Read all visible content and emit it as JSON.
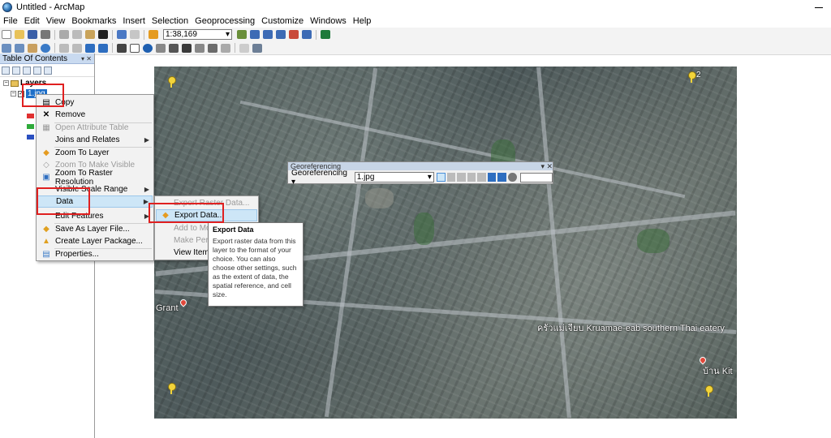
{
  "window": {
    "title": "Untitled - ArcMap"
  },
  "menu": [
    "File",
    "Edit",
    "View",
    "Bookmarks",
    "Insert",
    "Selection",
    "Geoprocessing",
    "Customize",
    "Windows",
    "Help"
  ],
  "toolbar": {
    "scale": "1:38,169"
  },
  "toc": {
    "title": "Table Of Contents",
    "layers_label": "Layers",
    "layer_name": "1.jpg",
    "bands": [
      "red",
      "green",
      "blue"
    ]
  },
  "context_menu": {
    "items": [
      {
        "label": "Copy",
        "icon": "copy-icon",
        "enabled": true
      },
      {
        "label": "Remove",
        "icon": "remove-icon",
        "enabled": true
      },
      {
        "label": "Open Attribute Table",
        "icon": "table-icon",
        "enabled": false
      },
      {
        "label": "Joins and Relates",
        "icon": "",
        "enabled": true,
        "submenu": true
      },
      {
        "label": "Zoom To Layer",
        "icon": "zoom-to-layer-icon",
        "enabled": true
      },
      {
        "label": "Zoom To Make Visible",
        "icon": "zoom-visible-icon",
        "enabled": false
      },
      {
        "label": "Zoom To Raster Resolution",
        "icon": "raster-resolution-icon",
        "enabled": true
      },
      {
        "label": "Visible Scale Range",
        "icon": "",
        "enabled": true,
        "submenu": true
      },
      {
        "label": "Data",
        "icon": "",
        "enabled": true,
        "submenu": true,
        "highlighted": true
      },
      {
        "label": "Edit Features",
        "icon": "",
        "enabled": true,
        "submenu": true
      },
      {
        "label": "Save As Layer File...",
        "icon": "save-layer-icon",
        "enabled": true
      },
      {
        "label": "Create Layer Package...",
        "icon": "layer-package-icon",
        "enabled": true
      },
      {
        "label": "Properties...",
        "icon": "properties-icon",
        "enabled": true
      }
    ]
  },
  "data_submenu": {
    "items": [
      {
        "label": "Export Data...",
        "highlighted": true
      },
      {
        "label": "Add to Mo",
        "enabled": false
      },
      {
        "label": "Make Perma",
        "enabled": false
      },
      {
        "label": "View Item D",
        "enabled": true
      }
    ]
  },
  "tooltip": {
    "title": "Export Data",
    "body": "Export raster data from this layer to the format of your choice. You can also choose other settings, such as the extent of data, the spatial reference, and cell size."
  },
  "georeferencing": {
    "title": "Georeferencing",
    "menu_label": "Georeferencing",
    "layer": "1.jpg"
  },
  "map": {
    "gcp_labels": [
      "2"
    ],
    "place_labels": [
      "Grant",
      "ครัวแม่เจียบ Kruamae-eab southern Thai eatery",
      "บ้าน Kit"
    ]
  },
  "colors": {
    "annotation": "#e02020",
    "highlight": "#cde6f7",
    "accent": "#1e6fc8"
  }
}
